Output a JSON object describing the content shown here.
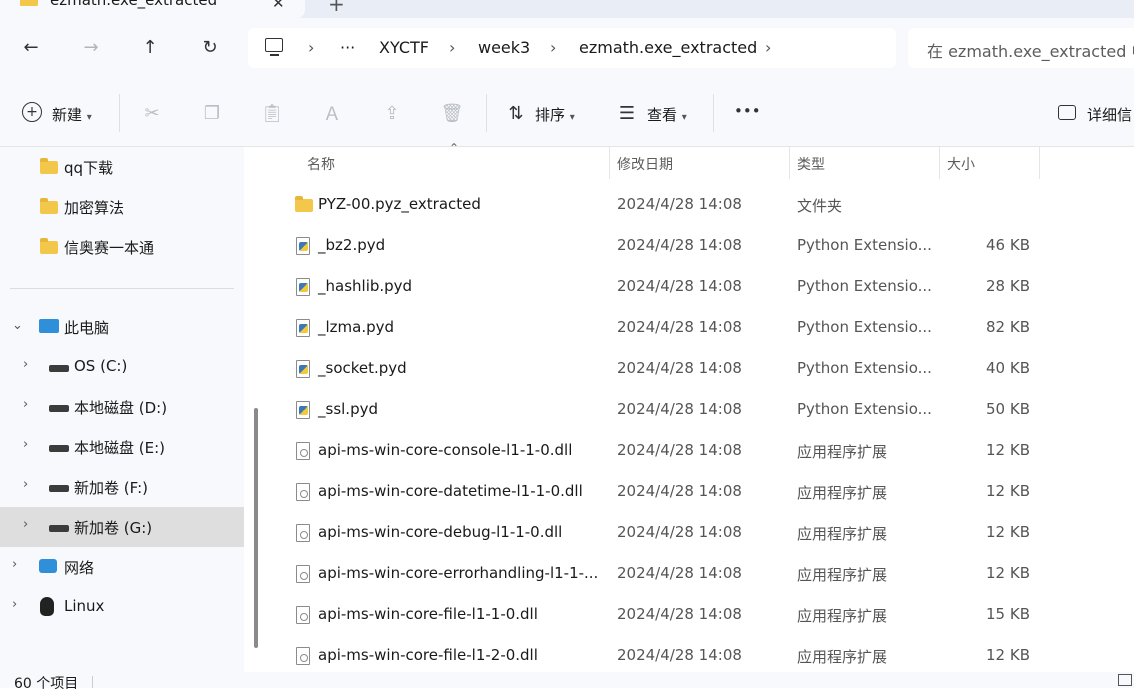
{
  "tab": {
    "title": "ezmath.exe_extracted",
    "close": "✕",
    "new": "+"
  },
  "nav": {
    "back": "←",
    "forward": "→",
    "up": "↑",
    "refresh": "↻",
    "ellipsis": "···",
    "breadcrumbs": [
      "XYCTF",
      "week3",
      "ezmath.exe_extracted"
    ],
    "separator": "›",
    "search_placeholder": "在 ezmath.exe_extracted 中"
  },
  "toolbar": {
    "new_label": "新建",
    "sort_label": "排序",
    "view_label": "查看",
    "more": "•••",
    "details_label": "详细信"
  },
  "sidebar": {
    "quick": [
      {
        "label": "qq下载"
      },
      {
        "label": "加密算法"
      },
      {
        "label": "信奥赛一本通"
      }
    ],
    "this_pc": "此电脑",
    "drives": [
      {
        "label": "OS (C:)"
      },
      {
        "label": "本地磁盘 (D:)"
      },
      {
        "label": "本地磁盘 (E:)"
      },
      {
        "label": "新加卷 (F:)"
      },
      {
        "label": "新加卷 (G:)",
        "selected": true
      }
    ],
    "network": "网络",
    "linux": "Linux"
  },
  "columns": {
    "name": "名称",
    "date": "修改日期",
    "type": "类型",
    "size": "大小"
  },
  "files": [
    {
      "name": "PYZ-00.pyz_extracted",
      "date": "2024/4/28 14:08",
      "type": "文件夹",
      "size": "",
      "kind": "folder"
    },
    {
      "name": "_bz2.pyd",
      "date": "2024/4/28 14:08",
      "type": "Python Extensio...",
      "size": "46 KB",
      "kind": "py"
    },
    {
      "name": "_hashlib.pyd",
      "date": "2024/4/28 14:08",
      "type": "Python Extensio...",
      "size": "28 KB",
      "kind": "py"
    },
    {
      "name": "_lzma.pyd",
      "date": "2024/4/28 14:08",
      "type": "Python Extensio...",
      "size": "82 KB",
      "kind": "py"
    },
    {
      "name": "_socket.pyd",
      "date": "2024/4/28 14:08",
      "type": "Python Extensio...",
      "size": "40 KB",
      "kind": "py"
    },
    {
      "name": "_ssl.pyd",
      "date": "2024/4/28 14:08",
      "type": "Python Extensio...",
      "size": "50 KB",
      "kind": "py"
    },
    {
      "name": "api-ms-win-core-console-l1-1-0.dll",
      "date": "2024/4/28 14:08",
      "type": "应用程序扩展",
      "size": "12 KB",
      "kind": "dll"
    },
    {
      "name": "api-ms-win-core-datetime-l1-1-0.dll",
      "date": "2024/4/28 14:08",
      "type": "应用程序扩展",
      "size": "12 KB",
      "kind": "dll"
    },
    {
      "name": "api-ms-win-core-debug-l1-1-0.dll",
      "date": "2024/4/28 14:08",
      "type": "应用程序扩展",
      "size": "12 KB",
      "kind": "dll"
    },
    {
      "name": "api-ms-win-core-errorhandling-l1-1-...",
      "date": "2024/4/28 14:08",
      "type": "应用程序扩展",
      "size": "12 KB",
      "kind": "dll"
    },
    {
      "name": "api-ms-win-core-file-l1-1-0.dll",
      "date": "2024/4/28 14:08",
      "type": "应用程序扩展",
      "size": "15 KB",
      "kind": "dll"
    },
    {
      "name": "api-ms-win-core-file-l1-2-0.dll",
      "date": "2024/4/28 14:08",
      "type": "应用程序扩展",
      "size": "12 KB",
      "kind": "dll"
    }
  ],
  "status": {
    "count": "60 个项目"
  }
}
